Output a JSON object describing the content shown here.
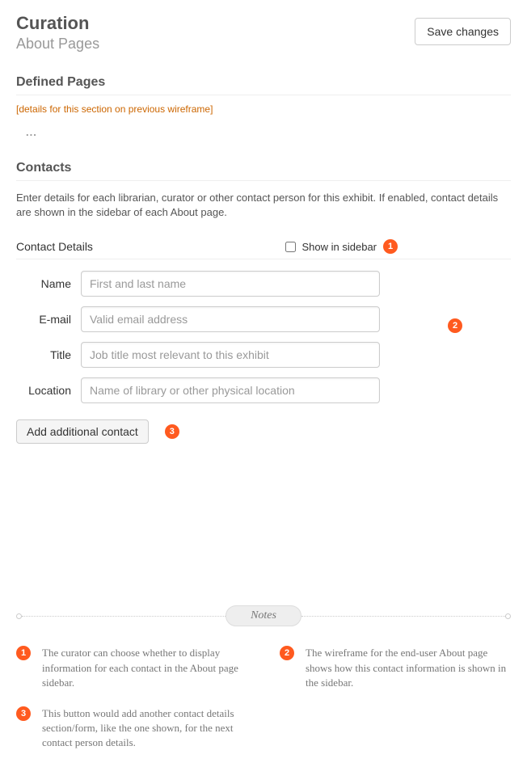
{
  "header": {
    "title": "Curation",
    "subtitle": "About Pages",
    "save_label": "Save changes"
  },
  "defined_pages": {
    "heading": "Defined Pages",
    "placeholder": "[details for this section on previous wireframe]",
    "ellipsis": "..."
  },
  "contacts": {
    "heading": "Contacts",
    "intro": "Enter details for each librarian, curator or other contact person for this exhibit. If enabled, contact details are shown in the sidebar of each About page.",
    "details_label": "Contact Details",
    "show_in_sidebar_label": "Show in sidebar",
    "fields": {
      "name": {
        "label": "Name",
        "placeholder": "First and last name"
      },
      "email": {
        "label": "E-mail",
        "placeholder": "Valid email address"
      },
      "title": {
        "label": "Title",
        "placeholder": "Job title most relevant to this exhibit"
      },
      "location": {
        "label": "Location",
        "placeholder": "Name of library or other physical location"
      }
    },
    "add_button": "Add additional contact"
  },
  "annotations": {
    "b1": "1",
    "b2": "2",
    "b3": "3"
  },
  "notes": {
    "label": "Notes",
    "items": {
      "n1": "The curator can choose whether to display information for each contact in the About page sidebar.",
      "n2": "The wireframe for the end-user About page shows how this contact information is shown in the sidebar.",
      "n3": "This button would add another contact details section/form, like the one shown, for the next contact person details."
    }
  }
}
